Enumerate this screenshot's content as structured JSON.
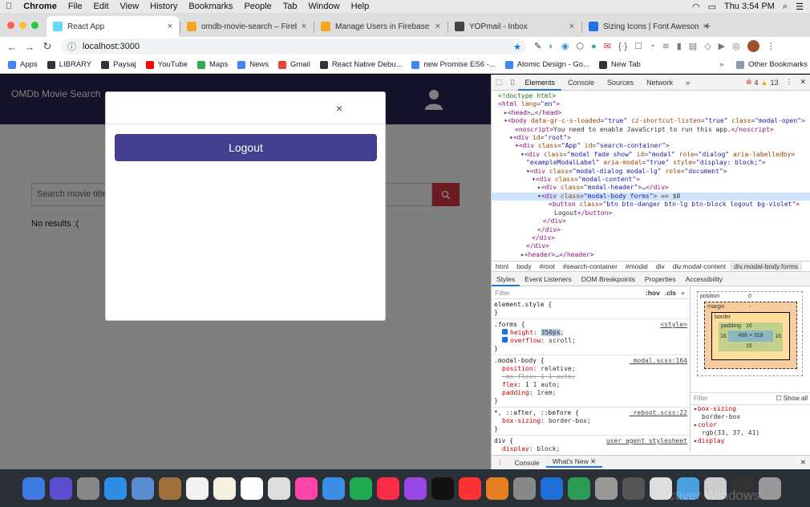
{
  "menubar": {
    "apple": "",
    "items": [
      "Chrome",
      "File",
      "Edit",
      "View",
      "History",
      "Bookmarks",
      "People",
      "Tab",
      "Window",
      "Help"
    ],
    "clock": "Thu 3:54 PM"
  },
  "tabs": [
    {
      "title": "React App",
      "active": true,
      "color": "#61dafb"
    },
    {
      "title": "omdb-movie-search – Firebase c",
      "active": false,
      "color": "#f6a623"
    },
    {
      "title": "Manage Users in Firebase | Fire",
      "active": false,
      "color": "#f6a623"
    },
    {
      "title": "YOPmail - Inbox",
      "active": false,
      "color": "#444444"
    },
    {
      "title": "Sizing Icons | Font Awesome",
      "active": false,
      "color": "#1a73e8"
    }
  ],
  "address": "localhost:3000",
  "bookmarks": [
    {
      "label": "Apps",
      "color": "#4285f4"
    },
    {
      "label": "LIBRARY",
      "color": "#333333"
    },
    {
      "label": "Paysaj",
      "color": "#333333"
    },
    {
      "label": "YouTube",
      "color": "#ff0000"
    },
    {
      "label": "Maps",
      "color": "#34a853"
    },
    {
      "label": "News",
      "color": "#4285f4"
    },
    {
      "label": "Gmail",
      "color": "#ea4335"
    },
    {
      "label": "React Native Debu...",
      "color": "#333333"
    },
    {
      "label": "new Promise ES6 -...",
      "color": "#4285f4"
    },
    {
      "label": "Atomic Design - Go...",
      "color": "#4285f4"
    },
    {
      "label": "New Tab",
      "color": "#333333"
    }
  ],
  "bookmarks_more": "»",
  "other_bookmarks": "Other Bookmarks",
  "app": {
    "brand": "OMDb Movie Search",
    "search_placeholder": "Search movie title",
    "no_results": "No results :(",
    "modal_close": "×",
    "logout_label": "Logout"
  },
  "devtools": {
    "tabs": [
      "Elements",
      "Console",
      "Sources",
      "Network"
    ],
    "more": "»",
    "errors": "4",
    "warnings": "13",
    "elements_lines": [
      {
        "indent": 0,
        "html": "<span class='cm'>&lt;!doctype html&gt;</span>"
      },
      {
        "indent": 0,
        "html": "<span class='tag'>&lt;html</span> <span class='at'>lang</span>=<span class='av'>\"en\"</span><span class='tag'>&gt;</span>"
      },
      {
        "indent": 1,
        "html": "▸<span class='tag'>&lt;head&gt;</span>…<span class='tag'>&lt;/head&gt;</span>"
      },
      {
        "indent": 1,
        "html": "▾<span class='tag'>&lt;body</span> <span class='at'>data-gr-c-s-loaded</span>=<span class='av'>\"true\"</span> <span class='at'>cz-shortcut-listen</span>=<span class='av'>\"true\"</span> <span class='at'>class</span>=<span class='av'>\"modal-open\"</span><span class='tag'>&gt;</span>"
      },
      {
        "indent": 3,
        "html": "<span class='tag'>&lt;noscript&gt;</span>You need to enable JavaScript to run this app.<span class='tag'>&lt;/noscript&gt;</span>"
      },
      {
        "indent": 2,
        "html": "▾<span class='tag'>&lt;div</span> <span class='at'>id</span>=<span class='av'>\"root\"</span><span class='tag'>&gt;</span>"
      },
      {
        "indent": 3,
        "html": "▾<span class='tag'>&lt;div</span> <span class='at'>class</span>=<span class='av'>\"App\"</span> <span class='at'>id</span>=<span class='av'>\"search-container\"</span><span class='tag'>&gt;</span>"
      },
      {
        "indent": 4,
        "html": "▾<span class='tag'>&lt;div</span> <span class='at'>class</span>=<span class='av'>\"modal fade show\"</span> <span class='at'>id</span>=<span class='av'>\"modal\"</span> <span class='at'>role</span>=<span class='av'>\"dialog\"</span> <span class='at'>aria-labelledby</span>="
      },
      {
        "indent": 5,
        "html": "<span class='av'>\"exampleModalLabel\"</span> <span class='at'>aria-modal</span>=<span class='av'>\"true\"</span> <span class='at'>style</span>=<span class='av'>\"display: block;\"</span><span class='tag'>&gt;</span>"
      },
      {
        "indent": 5,
        "html": "▾<span class='tag'>&lt;div</span> <span class='at'>class</span>=<span class='av'>\"modal-dialog modal-lg\"</span> <span class='at'>role</span>=<span class='av'>\"document\"</span><span class='tag'>&gt;</span>"
      },
      {
        "indent": 6,
        "html": "▾<span class='tag'>&lt;div</span> <span class='at'>class</span>=<span class='av'>\"modal-content\"</span><span class='tag'>&gt;</span>"
      },
      {
        "indent": 7,
        "html": "▸<span class='tag'>&lt;div</span> <span class='at'>class</span>=<span class='av'>\"modal-header\"</span><span class='tag'>&gt;</span>…<span class='tag'>&lt;/div&gt;</span>"
      },
      {
        "indent": 7,
        "html": "▾<span class='tag'>&lt;div</span> <span class='at'>class</span>=<span class='av'>\"modal-body forms\"</span><span class='tag'>&gt;</span> == $0",
        "sel": true
      },
      {
        "indent": 9,
        "html": "<span class='tag'>&lt;button</span> <span class='at'>class</span>=<span class='av'>\"btn btn-danger btn-lg btn-block logout bg-violet\"</span><span class='tag'>&gt;</span>"
      },
      {
        "indent": 10,
        "html": "Logout<span class='tag'>&lt;/button&gt;</span>"
      },
      {
        "indent": 8,
        "html": "<span class='tag'>&lt;/div&gt;</span>"
      },
      {
        "indent": 7,
        "html": "<span class='tag'>&lt;/div&gt;</span>"
      },
      {
        "indent": 6,
        "html": "<span class='tag'>&lt;/div&gt;</span>"
      },
      {
        "indent": 5,
        "html": "<span class='tag'>&lt;/div&gt;</span>"
      },
      {
        "indent": 4,
        "html": "▸<span class='tag'>&lt;header&gt;</span>…<span class='tag'>&lt;/header&gt;</span>"
      }
    ],
    "breadcrumbs": [
      "html",
      "body",
      "#root",
      "#search-container",
      "#modal",
      "div",
      "div.modal-content",
      "div.modal-body.forms"
    ],
    "subtabs": [
      "Styles",
      "Event Listeners",
      "DOM Breakpoints",
      "Properties",
      "Accessibility"
    ],
    "filter_placeholder": "Filter",
    "hov": ":hov",
    "cls": ".cls",
    "plus": "+",
    "element_style": "element.style {",
    "rules": [
      {
        "selector": ".forms {",
        "source": "<style>",
        "props": [
          [
            "height",
            "350px"
          ],
          [
            "overflow",
            "scroll"
          ]
        ]
      },
      {
        "selector": ".modal-body {",
        "source": "_modal.scss:164",
        "props": [
          [
            "position",
            "relative"
          ],
          [
            "-ms-flex",
            "1 1 auto"
          ],
          [
            "flex",
            "1 1 auto"
          ],
          [
            "padding",
            "1rem"
          ]
        ]
      },
      {
        "selector": "*, ::after, ::before {",
        "source": "_reboot.scss:22",
        "props": [
          [
            "box-sizing",
            "border-box"
          ]
        ]
      },
      {
        "selector": "div {",
        "source": "user agent stylesheet",
        "props": [
          [
            "display",
            "block"
          ]
        ]
      }
    ],
    "boxmodel": {
      "position": "position",
      "margin": "margin",
      "border": "border",
      "padding": "padding",
      "pos_val": "0",
      "margin_val": "-",
      "border_val": "-",
      "padding_val": "16",
      "content": "466 × 318",
      "side": "16",
      "left0": "0",
      "right0": "0"
    },
    "computed_filter": "Filter",
    "show_all": "Show all",
    "computed": [
      {
        "name": "box-sizing",
        "value": "border-box"
      },
      {
        "name": "color",
        "value": "rgb(33, 37, 41)"
      },
      {
        "name": "display",
        "value": ""
      }
    ],
    "console_tabs": [
      "Console",
      "What's New"
    ]
  },
  "watermark": "Activer Windows"
}
